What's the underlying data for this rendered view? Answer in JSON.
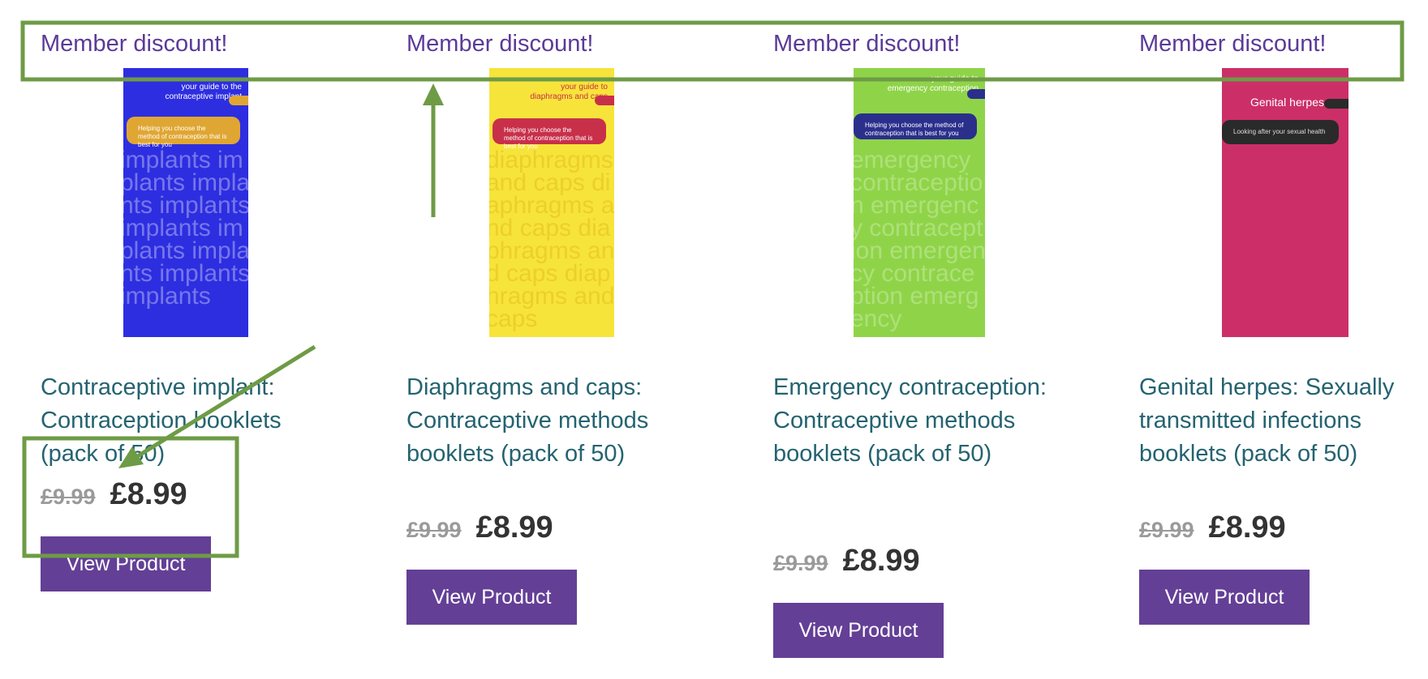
{
  "colors": {
    "badge_text": "#5b3a98",
    "title_text": "#246370",
    "button_bg": "#643f96",
    "old_price": "#9a9a9a",
    "new_price": "#333333",
    "annotation": "#6e9b46"
  },
  "products": [
    {
      "badge": "Member discount!",
      "cover": {
        "tagline_1": "your guide to the",
        "tagline_2": "contraceptive implant",
        "panel_text": "Helping you choose the method of contraception that is best for you",
        "watermark": "implants implants implants implants implants implants implants implants implants",
        "bg": "#2d2ee0",
        "panel_bg": "#e0a633",
        "pill_bg": "#e0a633"
      },
      "title": "Contraceptive implant: Contraception booklets (pack of 50)",
      "old_price": "£9.99",
      "new_price": "£8.99",
      "button": "View Product"
    },
    {
      "badge": "Member discount!",
      "cover": {
        "tagline_1": "your guide to",
        "tagline_2": "diaphragms and caps",
        "panel_text": "Helping you choose the method of contraception that is best for you",
        "watermark": "diaphragms and caps diaphragms and caps diaphragms and caps diaphragms and caps",
        "bg": "#f7e43a",
        "panel_bg": "#c8304a",
        "pill_bg": "#c8304a"
      },
      "title": "Diaphragms and caps: Contraceptive methods booklets (pack of 50)",
      "old_price": "£9.99",
      "new_price": "£8.99",
      "button": "View Product"
    },
    {
      "badge": "Member discount!",
      "cover": {
        "tagline_1": "your guide to",
        "tagline_2": "emergency contraception",
        "panel_text": "Helping you choose the method of contraception that is best for you",
        "watermark": "emergency contraception emergency contraception emergency contraception emergency",
        "bg": "#8fd448",
        "panel_bg": "#2b2f8c",
        "pill_bg": "#2b2f8c"
      },
      "title": "Emergency contraception: Contraceptive methods booklets (pack of 50)",
      "old_price": "£9.99",
      "new_price": "£8.99",
      "button": "View Product"
    },
    {
      "badge": "Member discount!",
      "cover": {
        "tagline_1": "",
        "tagline_2": "Genital herpes",
        "panel_text": "Looking after your sexual health",
        "watermark": "",
        "bg": "#cc2f68",
        "panel_bg": "#2a2a2a",
        "pill_bg": "#2a2a2a"
      },
      "title": "Genital herpes: Sexually transmitted infections booklets (pack of 50)",
      "old_price": "£9.99",
      "new_price": "£8.99",
      "button": "View Product"
    }
  ]
}
